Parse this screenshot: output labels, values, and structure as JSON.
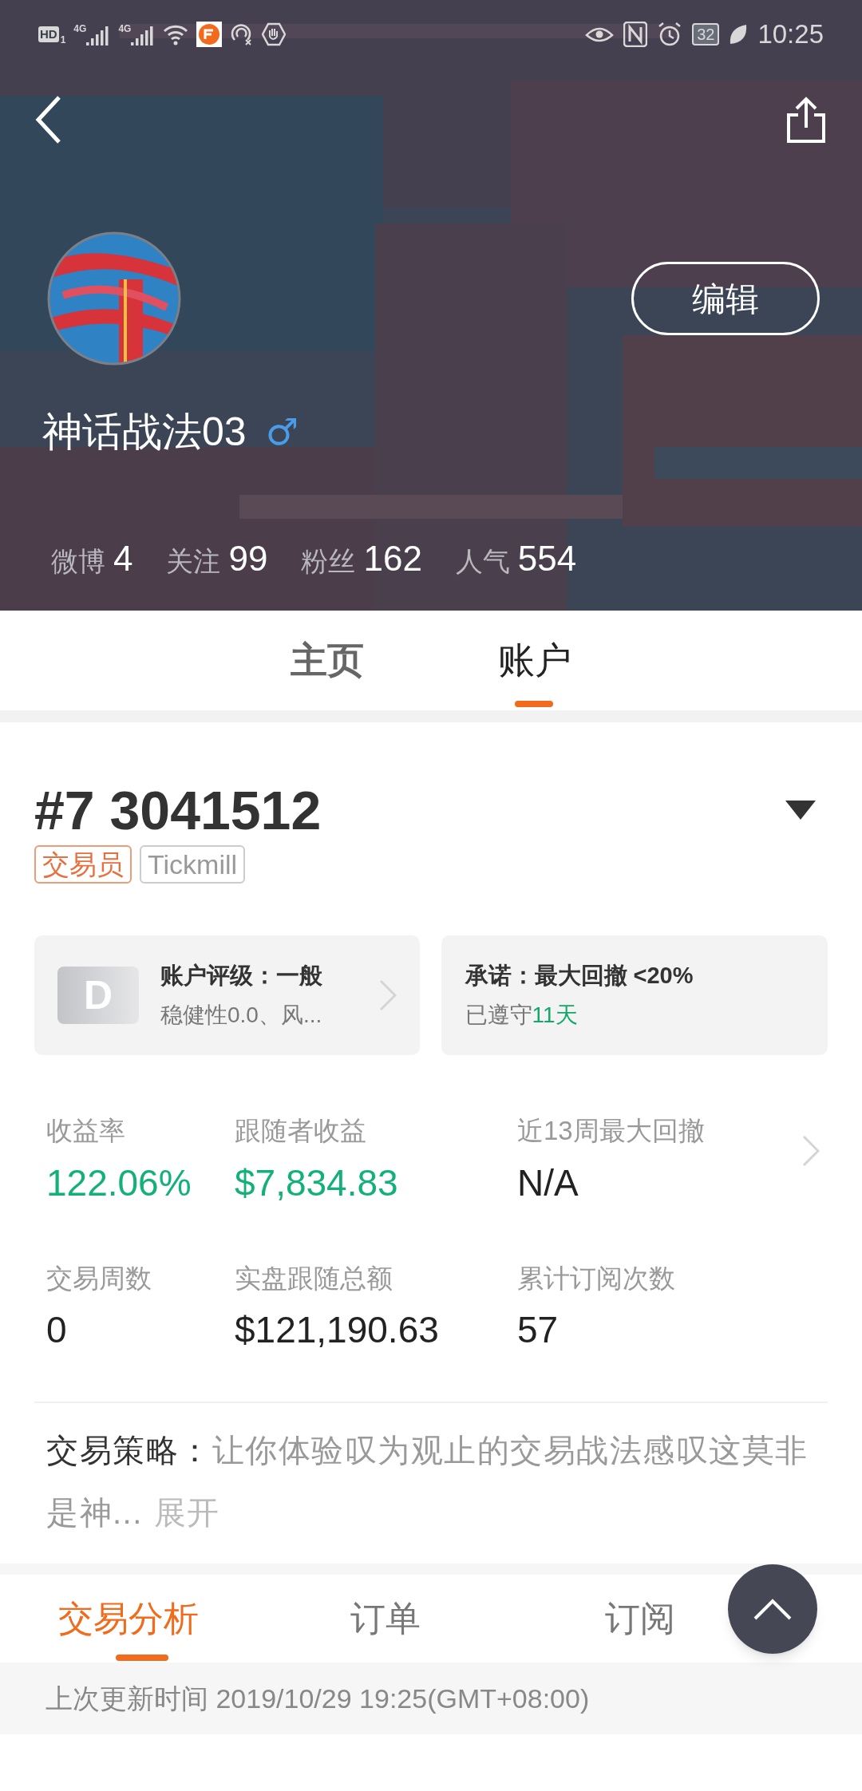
{
  "status_bar": {
    "hd": "HD",
    "sim": "1",
    "networks": [
      "4G",
      "4G"
    ],
    "battery": "32",
    "time": "10:25"
  },
  "profile": {
    "edit_button": "编辑",
    "name": "神话战法03",
    "gender_symbol": "♂",
    "stats": [
      {
        "label": "微博",
        "value": "4"
      },
      {
        "label": "关注",
        "value": "99"
      },
      {
        "label": "粉丝",
        "value": "162"
      },
      {
        "label": "人气",
        "value": "554"
      }
    ]
  },
  "tabs": [
    {
      "label": "主页",
      "selected": false
    },
    {
      "label": "账户",
      "selected": true
    }
  ],
  "account": {
    "number": "#7 3041512",
    "tags": [
      {
        "label": "交易员",
        "kind": "role"
      },
      {
        "label": "Tickmill",
        "kind": "broker"
      }
    ],
    "rating_card": {
      "grade": "D",
      "title": "账户评级：一般",
      "subtitle": "稳健性0.0、风..."
    },
    "promise_card": {
      "title": "承诺：最大回撤 <20%",
      "kept_prefix": "已遵守",
      "kept_days": "11天"
    },
    "metrics": [
      {
        "label": "收益率",
        "value": "122.06%",
        "positive": true
      },
      {
        "label": "跟随者收益",
        "value": "$7,834.83",
        "positive": true
      },
      {
        "label": "近13周最大回撤",
        "value": "N/A",
        "positive": false
      },
      {
        "label": "交易周数",
        "value": "0",
        "positive": false
      },
      {
        "label": "实盘跟随总额",
        "value": "$121,190.63",
        "positive": false
      },
      {
        "label": "累计订阅次数",
        "value": "57",
        "positive": false
      }
    ],
    "strategy": {
      "label": "交易策略：",
      "text": "让你体验叹为观止的交易战法感叹这莫非是神...",
      "expand": "展开"
    }
  },
  "bottom_tabs": [
    {
      "label": "交易分析",
      "selected": true
    },
    {
      "label": "订单",
      "selected": false
    },
    {
      "label": "订阅",
      "selected": false
    }
  ],
  "last_update": "上次更新时间 2019/10/29 19:25(GMT+08:00)"
}
